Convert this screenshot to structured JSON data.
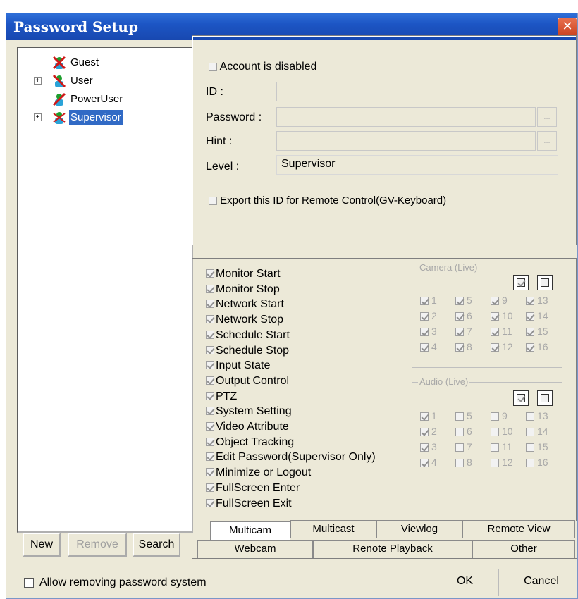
{
  "window": {
    "title": "Password Setup",
    "close_icon": "close-icon"
  },
  "tree": {
    "nodes": [
      {
        "label": "Guest",
        "expandable": false,
        "selected": false
      },
      {
        "label": "User",
        "expandable": true,
        "selected": false
      },
      {
        "label": "PowerUser",
        "expandable": false,
        "selected": false
      },
      {
        "label": "Supervisor",
        "expandable": true,
        "selected": true
      }
    ]
  },
  "left_buttons": {
    "new": "New",
    "remove": "Remove",
    "search": "Search"
  },
  "account": {
    "disabled_label": "Account is disabled",
    "id_label": "ID :",
    "id_value": "",
    "password_label": "Password :",
    "password_value": "",
    "hint_label": "Hint :",
    "hint_value": "",
    "level_label": "Level :",
    "level_value": "Supervisor",
    "export_label": "Export this ID for Remote Control(GV-Keyboard)",
    "browse_label": "..."
  },
  "permissions": [
    {
      "label": "Monitor Start",
      "checked": true
    },
    {
      "label": "Monitor Stop",
      "checked": true
    },
    {
      "label": "Network Start",
      "checked": true
    },
    {
      "label": "Network Stop",
      "checked": true
    },
    {
      "label": "Schedule Start",
      "checked": true
    },
    {
      "label": "Schedule Stop",
      "checked": true
    },
    {
      "label": "Input State",
      "checked": true
    },
    {
      "label": "Output Control",
      "checked": true
    },
    {
      "label": "PTZ",
      "checked": true
    },
    {
      "label": "System Setting",
      "checked": true
    },
    {
      "label": "Video Attribute",
      "checked": true
    },
    {
      "label": "Object Tracking",
      "checked": true
    },
    {
      "label": "Edit Password(Supervisor Only)",
      "checked": true
    },
    {
      "label": "Minimize or Logout",
      "checked": true
    },
    {
      "label": "FullScreen Enter",
      "checked": true
    },
    {
      "label": "FullScreen Exit",
      "checked": true
    }
  ],
  "camera_group": {
    "title": "Camera (Live)",
    "numbers": [
      "1",
      "2",
      "3",
      "4",
      "5",
      "6",
      "7",
      "8",
      "9",
      "10",
      "11",
      "12",
      "13",
      "14",
      "15",
      "16"
    ],
    "checked": [
      true,
      true,
      true,
      true,
      true,
      true,
      true,
      true,
      true,
      true,
      true,
      true,
      true,
      true,
      true,
      true
    ]
  },
  "audio_group": {
    "title": "Audio (Live)",
    "numbers": [
      "1",
      "2",
      "3",
      "4",
      "5",
      "6",
      "7",
      "8",
      "9",
      "10",
      "11",
      "12",
      "13",
      "14",
      "15",
      "16"
    ],
    "checked": [
      true,
      true,
      true,
      true,
      false,
      false,
      false,
      false,
      false,
      false,
      false,
      false,
      false,
      false,
      false,
      false
    ]
  },
  "tabs": {
    "row1": [
      "Multicam",
      "Multicast",
      "Viewlog",
      "Remote View"
    ],
    "row2": [
      "Webcam",
      "Renote Playback",
      "Other"
    ],
    "active": "Multicam"
  },
  "footer": {
    "allow_label": "Allow removing password system",
    "allow_checked": false,
    "ok": "OK",
    "cancel": "Cancel"
  }
}
